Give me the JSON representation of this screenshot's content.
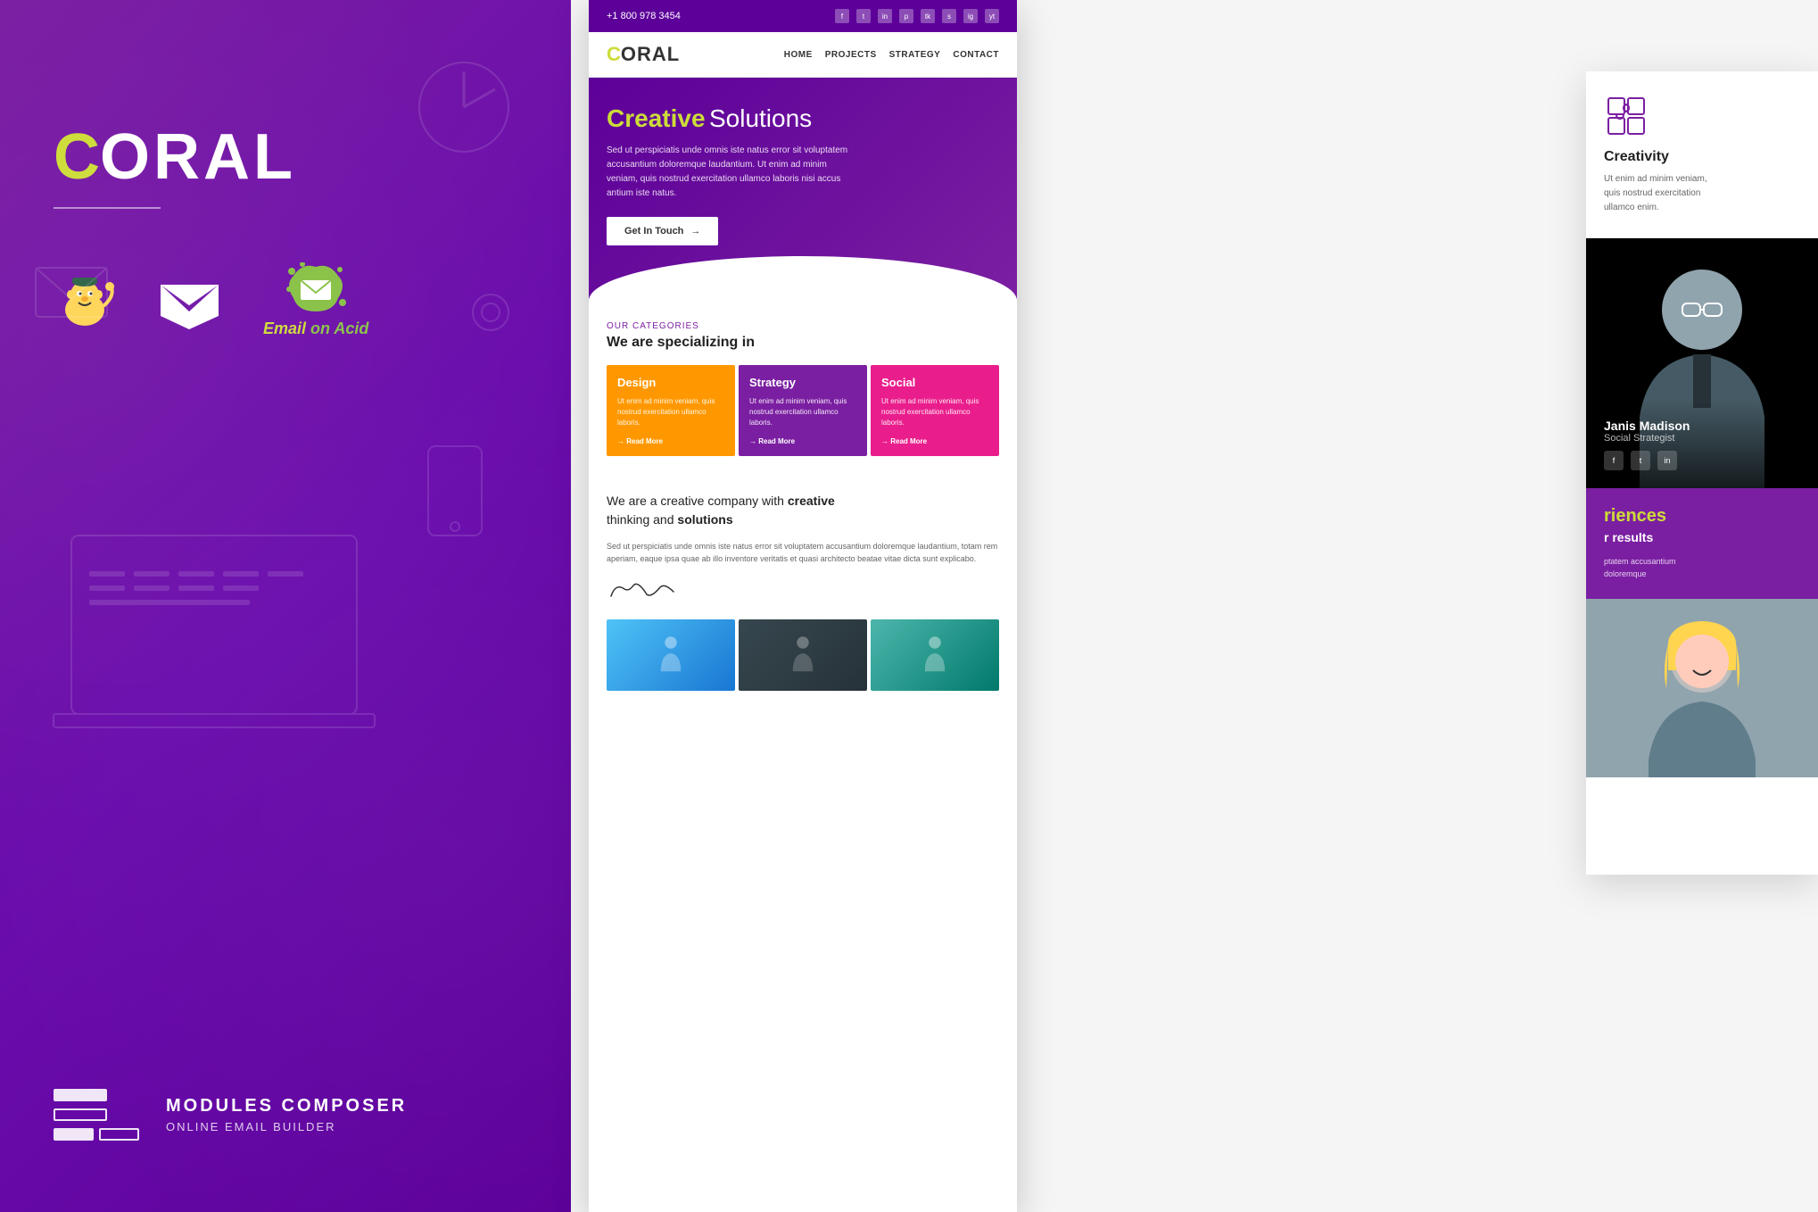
{
  "left": {
    "logo": {
      "c": "C",
      "rest": "ORAL"
    },
    "partners": {
      "mailchimp_label": "Mailchimp",
      "campaign_label": "Campaign Monitor",
      "emailacid_label": "Email on Acid",
      "emailacid_line1": "Email",
      "emailacid_line2": "on Acid"
    },
    "bottom": {
      "main_title": "MODULES COMPOSER",
      "sub_title": "ONLINE EMAIL BUILDER"
    }
  },
  "email": {
    "topbar": {
      "phone": "+1 800 978 3454"
    },
    "header": {
      "logo_c": "C",
      "logo_rest": "ORAL",
      "nav": [
        "HOME",
        "PROJECTS",
        "STRATEGY",
        "CONTACT"
      ]
    },
    "hero": {
      "headline_creative": "Creative",
      "headline_rest": " Solutions",
      "description": "Sed ut perspiciatis unde omnis iste natus error sit voluptatem accusantium doloremque laudantium. Ut enim ad minim veniam, quis nostrud exercitation ullamco laboris nisi accus antium iste natus.",
      "button_text": "Get In Touch",
      "button_arrow": "→"
    },
    "categories": {
      "label": "Our Categories",
      "title": "We are specializing in",
      "cards": [
        {
          "id": "design",
          "title": "Design",
          "desc": "Ut enim ad minim veniam, quis nostrud exercitation ullamco laboris.",
          "link": "→ Read More",
          "color": "design"
        },
        {
          "id": "strategy",
          "title": "Strategy",
          "desc": "Ut enim ad minim veniam, quis nostrud exercitation ullamco laboris.",
          "link": "→ Read More",
          "color": "strategy"
        },
        {
          "id": "social",
          "title": "Social",
          "desc": "Ut enim ad minim veniam, quis nostrud exercitation ullamco laboris.",
          "link": "→ Read More",
          "color": "social"
        }
      ]
    },
    "creative_section": {
      "title_part1": "We are a creative company with ",
      "title_bold1": "creative",
      "title_part2": " thinking and ",
      "title_bold2": "solutions",
      "description": "Sed ut perspiciatis unde omnis iste natus error sit voluptatem accusantium doloremque laudantium, totam rem aperiam, eaque ipsa quae ab illo inventore veritatis et quasi architecto beatae vitae dicta sunt explicabo."
    }
  },
  "right_panel": {
    "creativity": {
      "title": "Creativity",
      "desc": "Ut enim ad minim veniam, quis nostrud exercitation ullamco enim."
    },
    "team_member": {
      "name": "Janis Madison",
      "role": "Social Strategist"
    },
    "experiences": {
      "title": "riences",
      "subtitle": "r results",
      "desc": "ptatem accusantium doloremque"
    }
  }
}
